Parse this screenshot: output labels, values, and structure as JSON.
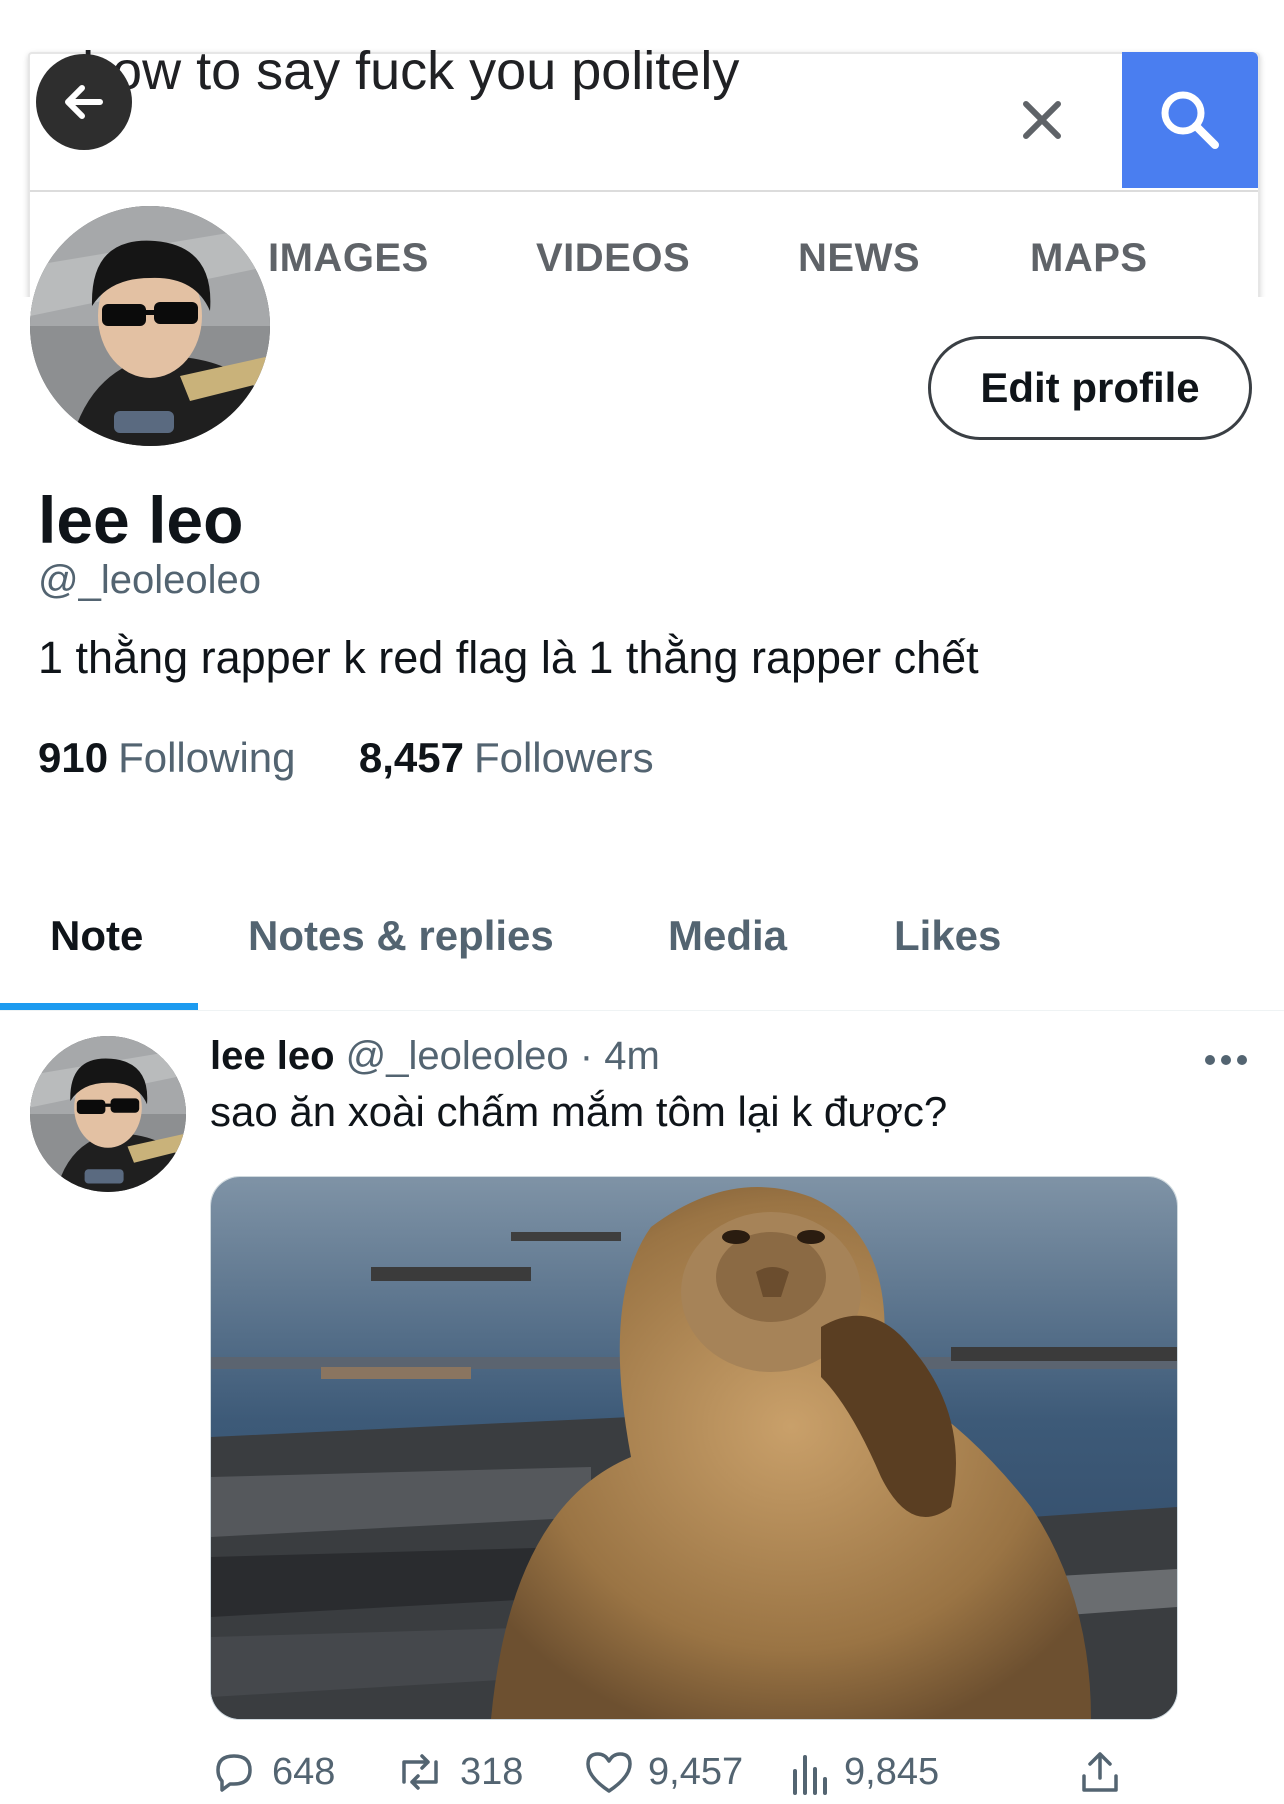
{
  "search": {
    "query": "how to say fuck you politely",
    "tabs": [
      "IMAGES",
      "VIDEOS",
      "NEWS",
      "MAPS"
    ],
    "accent": "#4a7ef0"
  },
  "profile": {
    "display_name": "lee leo",
    "handle": "@_leoleoleo",
    "bio": "1 thằng rapper k red flag là 1 thằng rapper chết",
    "following_count": "910",
    "following_label": "Following",
    "followers_count": "8,457",
    "followers_label": "Followers",
    "edit_button": "Edit profile"
  },
  "profile_tabs": [
    {
      "label": "Note",
      "active": true
    },
    {
      "label": "Notes & replies",
      "active": false
    },
    {
      "label": "Media",
      "active": false
    },
    {
      "label": "Likes",
      "active": false
    }
  ],
  "post": {
    "author_name": "lee leo",
    "author_handle": "@_leoleoleo",
    "separator": "·",
    "time": "4m",
    "text": "sao ăn xoài chấm mắm tôm lại k được?",
    "replies": "648",
    "reposts": "318",
    "likes": "9,457",
    "views": "9,845"
  },
  "icons": {
    "back": "arrow-left-icon",
    "clear": "close-icon",
    "search": "search-icon",
    "more": "more-horizontal-icon",
    "reply": "comment-icon",
    "repost": "repost-icon",
    "like": "heart-icon",
    "views": "views-chart-icon",
    "share": "share-icon"
  },
  "colors": {
    "tab_indicator": "#1d9bf0",
    "secondary_text": "#536471"
  }
}
